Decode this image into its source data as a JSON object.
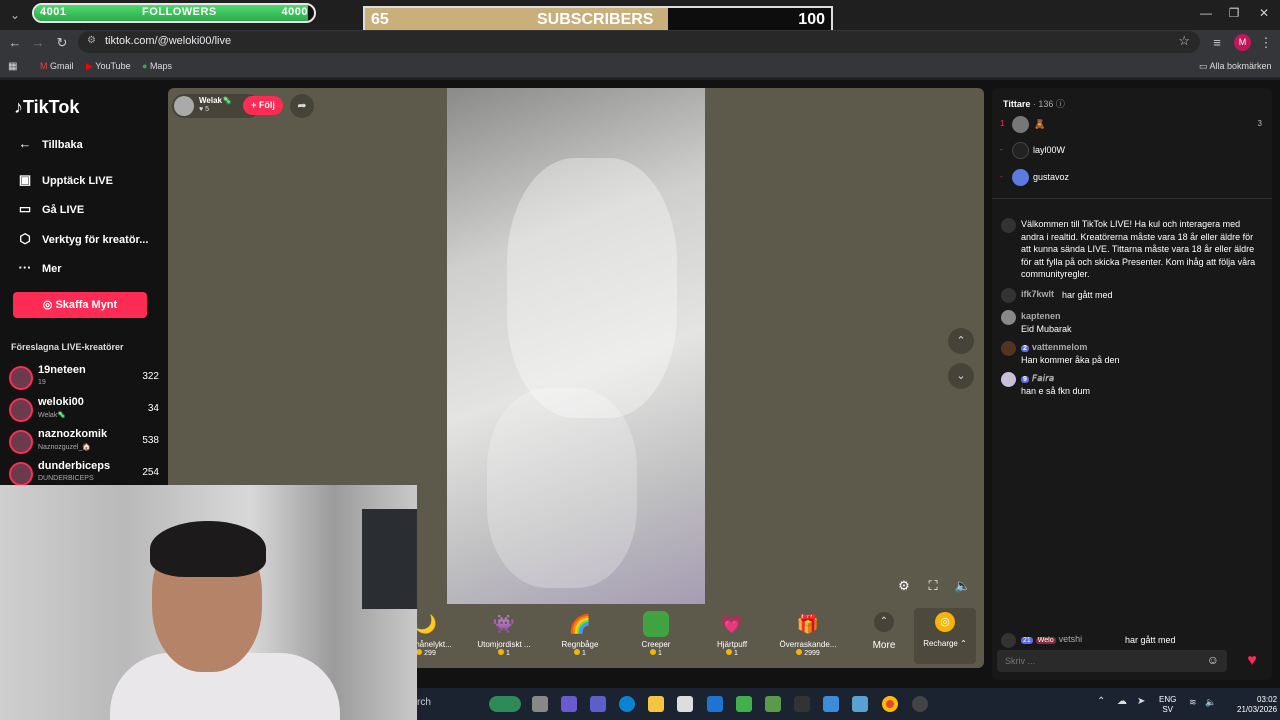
{
  "overlay": {
    "followers": {
      "left": "4001",
      "label": "FOLLOWERS",
      "right": "4000",
      "progress": 0.98
    },
    "subscribers": {
      "left": "65",
      "label": "SUBSCRIBERS",
      "right": "100",
      "progress": 0.65
    }
  },
  "browser": {
    "url": "tiktok.com/@weloki00/live",
    "bookmarks": [
      "Gmail",
      "YouTube",
      "Maps"
    ],
    "all_bookmarks": "Alla bokmärken",
    "profile_initial": "M",
    "profile_color": "#c2185b"
  },
  "sidebar": {
    "logo": "TikTok",
    "back": "Tillbaka",
    "items": [
      {
        "label": "Upptäck LIVE",
        "icon": "live-tv-icon"
      },
      {
        "label": "Gå LIVE",
        "icon": "camera-icon"
      },
      {
        "label": "Verktyg för kreatör...",
        "icon": "tools-icon"
      },
      {
        "label": "Mer",
        "icon": "more-icon"
      }
    ],
    "coin_button": "Skaffa Mynt",
    "suggested_heading": "Föreslagna LIVE-kreatörer",
    "creators": [
      {
        "name": "19neteen",
        "sub": "19",
        "count": "322"
      },
      {
        "name": "weloki00",
        "sub": "Welak🦠",
        "count": "34"
      },
      {
        "name": "naznozkomik",
        "sub": "Naznozguzel_🏠",
        "count": "538"
      },
      {
        "name": "dunderbiceps",
        "sub": "DUNDERBICEPS",
        "count": "254"
      }
    ]
  },
  "stream": {
    "host_name": "Welak🦠",
    "host_likes": "5",
    "follow_label": "+ Följ",
    "gifts": [
      {
        "name": "Silvmånelykt...",
        "price": "299",
        "icon": "🌙",
        "bg": "#d8b45a"
      },
      {
        "name": "Utomjordiskt ...",
        "price": "1",
        "icon": "👾",
        "bg": "#b07ab0"
      },
      {
        "name": "Regnbåge",
        "price": "1",
        "icon": "🌈",
        "bg": "transparent"
      },
      {
        "name": "Creeper",
        "price": "1",
        "icon": "",
        "bg": "#3fa33f"
      },
      {
        "name": "Hjärtpuff",
        "price": "1",
        "icon": "💗",
        "bg": "transparent"
      },
      {
        "name": "Överraskande...",
        "price": "2999",
        "icon": "🎁",
        "bg": "#9a8a6a"
      }
    ],
    "more_label": "More",
    "recharge_label": "Recharge"
  },
  "chat": {
    "viewers_label": "Tittare",
    "viewers_count": "· 136",
    "top_count": "3",
    "viewers": [
      {
        "rank": "1",
        "name": "🧸",
        "color": "#777"
      },
      {
        "rank": "-",
        "name": "layl00W",
        "color": "#222"
      },
      {
        "rank": "-",
        "name": "gustavoz",
        "color": "#5c7ae0"
      }
    ],
    "welcome": "Välkommen till TikTok LIVE! Ha kul och interagera med andra i realtid. Kreatörerna måste vara 18 år eller äldre för att kunna sända LIVE. Tittarna måste vara 18 år eller äldre för att fylla på och skicka Presenter. Kom ihåg att följa våra communityregler.",
    "messages": [
      {
        "user": "ifk7kwlt",
        "text": "har gått med",
        "badge": ""
      },
      {
        "user": "kaptenen",
        "text": "Eid Mubarak",
        "badge": ""
      },
      {
        "user": "vattenmelom",
        "text": "Han kommer åka på den",
        "badge": "2"
      },
      {
        "user": "𝘍𝘢𝘪𝘳𝘢",
        "text": "han e så fkn dum",
        "badge": "9"
      }
    ],
    "join_user": "vetshi",
    "join_text": "har gått med",
    "join_badge": "21",
    "join_tag": "Welo",
    "input_placeholder": "Skriv ..."
  },
  "taskbar": {
    "search_text": "rch",
    "lang1": "ENG",
    "lang2": "SV",
    "time": "03:02",
    "date": "21/03/2026"
  }
}
